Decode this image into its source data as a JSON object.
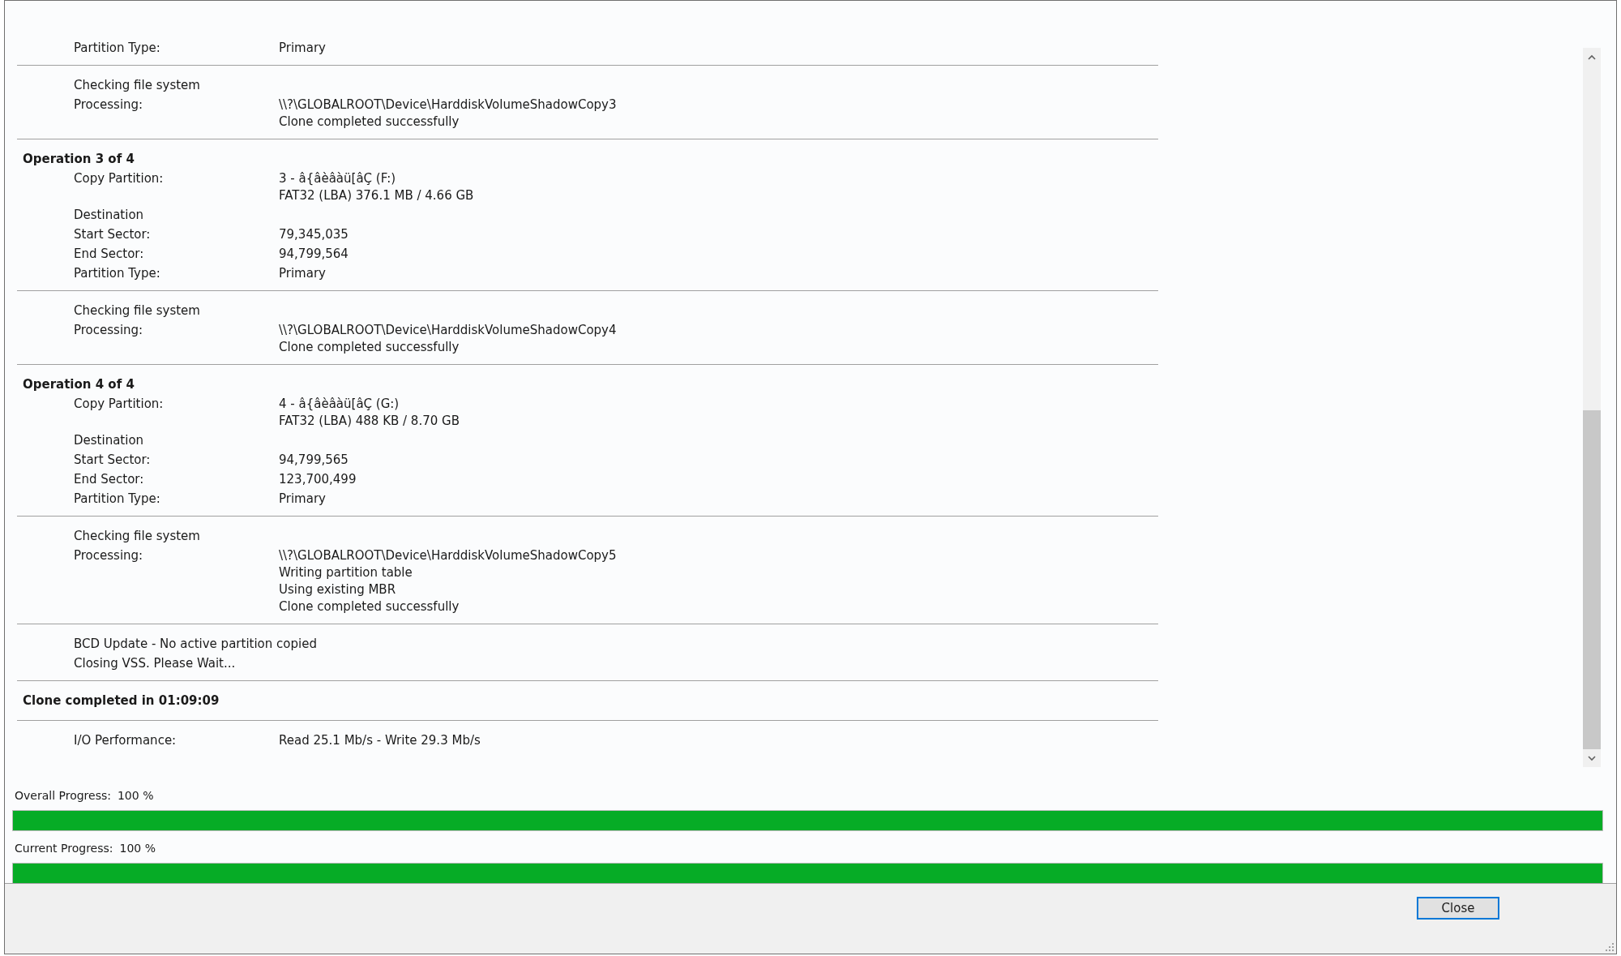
{
  "log": {
    "sections": [
      {
        "rows": [
          {
            "label": "Partition Type:",
            "values": [
              "Primary"
            ]
          }
        ]
      },
      {
        "rows": [
          {
            "label": "Checking file system"
          },
          {
            "label": "Processing:",
            "values": [
              "\\\\?\\GLOBALROOT\\Device\\HarddiskVolumeShadowCopy3",
              "Clone completed successfully"
            ]
          }
        ]
      },
      {
        "heading": "Operation 3 of 4",
        "rows": [
          {
            "label": "Copy Partition:",
            "values": [
              "3 - â{âèâàü[âÇ (F:)",
              "FAT32 (LBA) 376.1 MB / 4.66 GB"
            ]
          },
          {
            "label": "Destination"
          },
          {
            "label": "Start Sector:",
            "values": [
              "79,345,035"
            ]
          },
          {
            "label": "End Sector:",
            "values": [
              "94,799,564"
            ]
          },
          {
            "label": "Partition Type:",
            "values": [
              "Primary"
            ]
          }
        ]
      },
      {
        "rows": [
          {
            "label": "Checking file system"
          },
          {
            "label": "Processing:",
            "values": [
              "\\\\?\\GLOBALROOT\\Device\\HarddiskVolumeShadowCopy4",
              "Clone completed successfully"
            ]
          }
        ]
      },
      {
        "heading": "Operation 4 of 4",
        "rows": [
          {
            "label": "Copy Partition:",
            "values": [
              "4 - â{âèâàü[âÇ (G:)",
              "FAT32 (LBA) 488 KB / 8.70 GB"
            ]
          },
          {
            "label": "Destination"
          },
          {
            "label": "Start Sector:",
            "values": [
              "94,799,565"
            ]
          },
          {
            "label": "End Sector:",
            "values": [
              "123,700,499"
            ]
          },
          {
            "label": "Partition Type:",
            "values": [
              "Primary"
            ]
          }
        ]
      },
      {
        "rows": [
          {
            "label": "Checking file system"
          },
          {
            "label": "Processing:",
            "values": [
              "\\\\?\\GLOBALROOT\\Device\\HarddiskVolumeShadowCopy5",
              "Writing partition table",
              "Using existing MBR",
              "Clone completed successfully"
            ]
          }
        ]
      },
      {
        "rows": [
          {
            "label": "BCD Update - No active partition copied"
          },
          {
            "label": "Closing VSS. Please Wait..."
          }
        ]
      },
      {
        "heading": "Clone completed in 01:09:09"
      },
      {
        "rows": [
          {
            "label": "I/O Performance:",
            "values": [
              "Read 25.1 Mb/s - Write 29.3 Mb/s"
            ]
          }
        ]
      }
    ]
  },
  "progress": [
    {
      "label": "Overall Progress:",
      "reading": "100 %",
      "level": 1
    },
    {
      "label": "Current Progress:",
      "reading": "100 %",
      "level": 1
    }
  ],
  "buttons": [
    {
      "label": "Close",
      "focused": true
    }
  ]
}
